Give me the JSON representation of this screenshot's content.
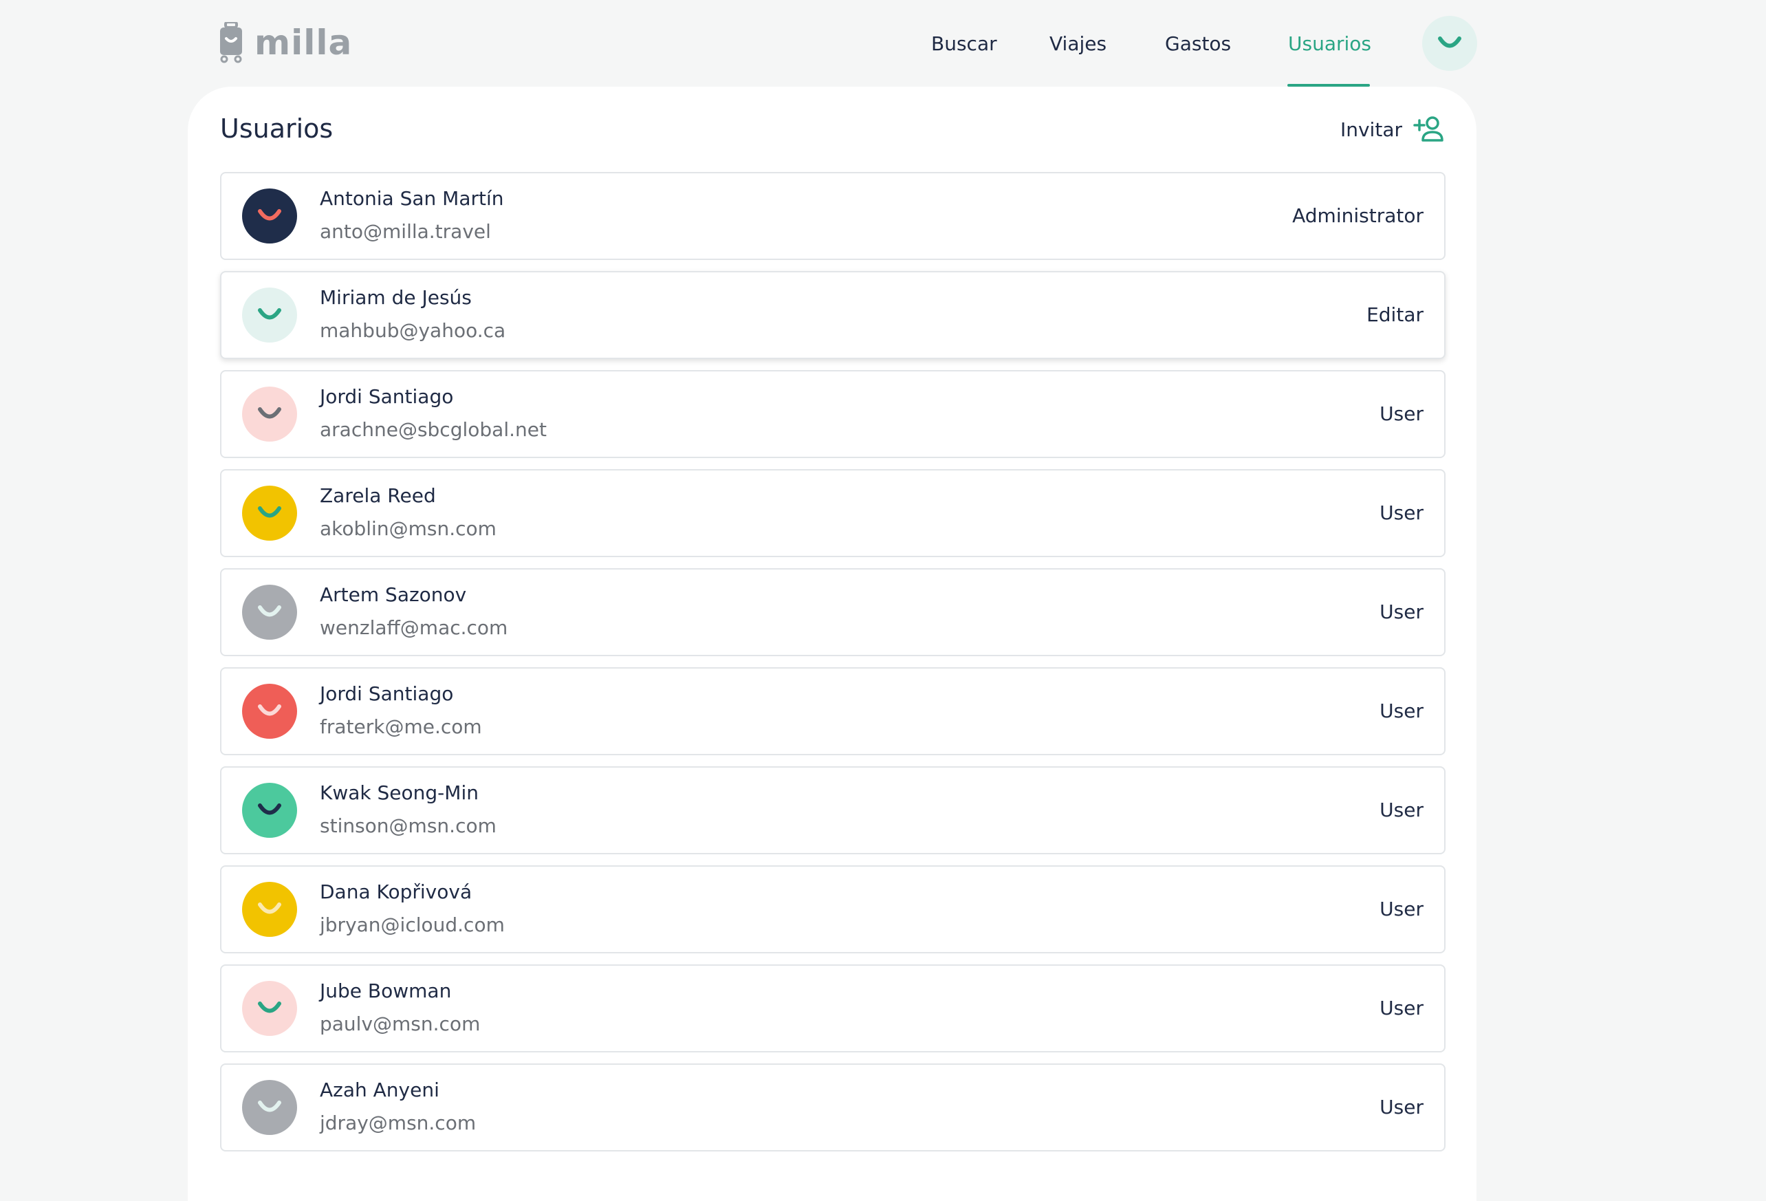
{
  "app": {
    "logo_text": "milla",
    "brand_color": "#2aa584"
  },
  "nav": {
    "items": [
      {
        "label": "Buscar",
        "active": false
      },
      {
        "label": "Viajes",
        "active": false
      },
      {
        "label": "Gastos",
        "active": false
      },
      {
        "label": "Usuarios",
        "active": true
      }
    ],
    "avatar_icon": "smile-icon"
  },
  "page": {
    "title": "Usuarios",
    "invite_label": "Invitar",
    "invite_icon": "add-user-icon"
  },
  "users": [
    {
      "name": "Antonia San Martín",
      "email": "anto@milla.travel",
      "role": "Administrator",
      "avatar_bg": "#1f2d4a",
      "smile": "#f26b5f"
    },
    {
      "name": "Miriam de Jesús",
      "email": "mahbub@yahoo.ca",
      "role": "Editar",
      "avatar_bg": "#e3f2ef",
      "smile": "#2aa584"
    },
    {
      "name": "Jordi Santiago",
      "email": "arachne@sbcglobal.net",
      "role": "User",
      "avatar_bg": "#fbd9d7",
      "smile": "#6b6f75"
    },
    {
      "name": "Zarela Reed",
      "email": "akoblin@msn.com",
      "role": "User",
      "avatar_bg": "#f2c300",
      "smile": "#2aa584"
    },
    {
      "name": "Artem Sazonov",
      "email": "wenzlaff@mac.com",
      "role": "User",
      "avatar_bg": "#a8abb0",
      "smile": "#e3f2ef"
    },
    {
      "name": "Jordi Santiago",
      "email": "fraterk@me.com",
      "role": "User",
      "avatar_bg": "#ef5e57",
      "smile": "#fbd9d7"
    },
    {
      "name": "Kwak Seong-Min",
      "email": "stinson@msn.com",
      "role": "User",
      "avatar_bg": "#4cc99d",
      "smile": "#1f2d4a"
    },
    {
      "name": "Dana Kopřivová",
      "email": "jbryan@icloud.com",
      "role": "User",
      "avatar_bg": "#f2c300",
      "smile": "#fbe9b0"
    },
    {
      "name": "Jube Bowman",
      "email": "paulv@msn.com",
      "role": "User",
      "avatar_bg": "#fbd9d7",
      "smile": "#2aa584"
    },
    {
      "name": "Azah Anyeni",
      "email": "jdray@msn.com",
      "role": "User",
      "avatar_bg": "#a8abb0",
      "smile": "#e3f2ef"
    }
  ]
}
